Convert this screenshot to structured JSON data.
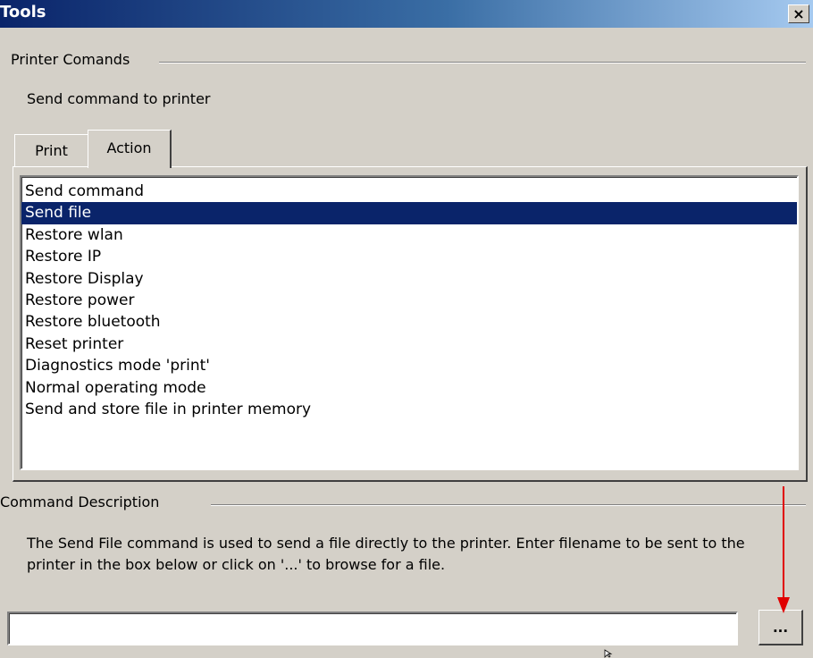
{
  "window": {
    "title": "Tools",
    "close_label": "×"
  },
  "printer_group": {
    "label": "Printer Comands",
    "subtitle": "Send command to printer"
  },
  "tabs": [
    {
      "label": "Print",
      "active": false
    },
    {
      "label": "Action",
      "active": true
    }
  ],
  "actions": {
    "selected": "Send file",
    "items": [
      "Send command",
      "Send file",
      "Restore wlan",
      "Restore IP",
      "Restore Display",
      "Restore power",
      "Restore bluetooth",
      "Reset printer",
      "Diagnostics mode 'print'",
      "Normal operating mode",
      "Send and store file in printer memory"
    ]
  },
  "description_group": {
    "label": "Command Description",
    "text": "The Send File command is used to send a file directly to the printer. Enter filename to be sent to the printer in the box below or click on '...' to browse for a file."
  },
  "filename": {
    "value": "",
    "placeholder": ""
  },
  "browse_button": {
    "label": "..."
  },
  "colors": {
    "window_bg": "#d4d0c8",
    "titlebar_start": "#0a246a",
    "titlebar_end": "#a6caf0",
    "selection": "#0a246a",
    "annotation_arrow": "#e00000"
  },
  "icons": {
    "close": "close-icon",
    "cursor": "mouse-cursor-icon",
    "annotation": "red-arrow-icon"
  }
}
